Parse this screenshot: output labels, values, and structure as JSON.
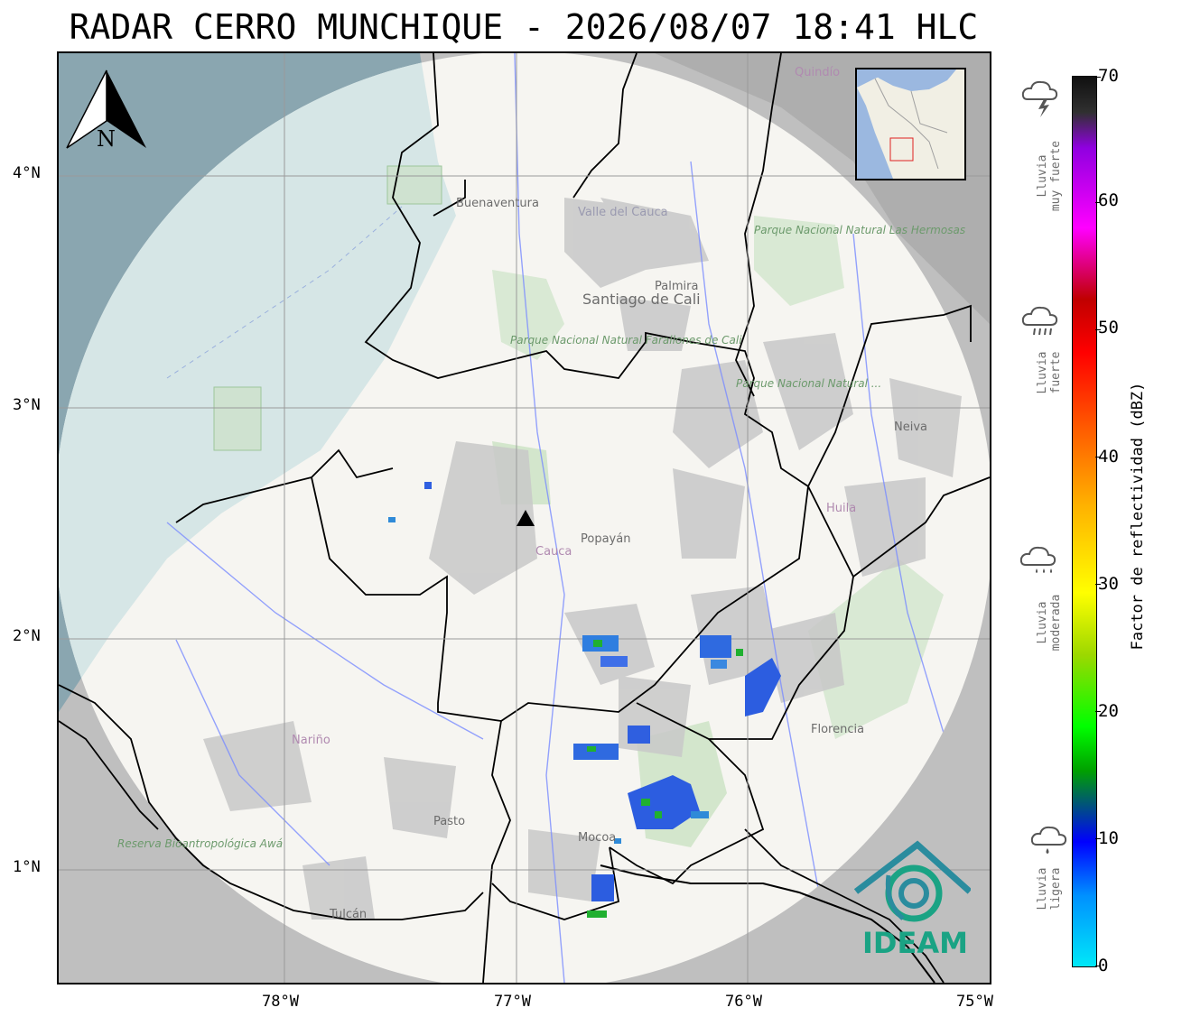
{
  "title": "RADAR CERRO MUNCHIQUE - 2026/08/07 18:41 HLC",
  "map": {
    "lat_ticks": [
      "4°N",
      "3°N",
      "2°N",
      "1°N"
    ],
    "lon_ticks": [
      "78°W",
      "77°W",
      "76°W",
      "75°W"
    ],
    "place_labels": [
      "Buenaventura",
      "Valle del Cauca",
      "Palmira",
      "Santiago de Cali",
      "Parque Nacional Natural Farallones de Cali",
      "Parque Nacional Natural Las Hermosas",
      "Parque Nacional Natural ...",
      "Neiva",
      "Huila",
      "Cauca",
      "Popayán",
      "Nariño",
      "Pasto",
      "Mocoa",
      "Florencia",
      "Reserva Bioantropológica Awá",
      "Tulcán",
      "Quindío"
    ],
    "north_label": "N",
    "radar_site_marker": "triangle-marker"
  },
  "logo": {
    "text": "IDEAM",
    "color": "#1aa384"
  },
  "colorbar": {
    "label": "Factor de reflectividad (dBZ)",
    "ticks": [
      "0",
      "10",
      "20",
      "30",
      "40",
      "50",
      "60",
      "70"
    ],
    "min": 0,
    "max": 70,
    "rain_levels": [
      {
        "label_line1": "Lluvia",
        "label_line2": "ligera",
        "icon": "light-rain-icon"
      },
      {
        "label_line1": "Lluvia",
        "label_line2": "moderada",
        "icon": "moderate-rain-icon"
      },
      {
        "label_line1": "Lluvia",
        "label_line2": "fuerte",
        "icon": "heavy-rain-icon"
      },
      {
        "label_line1": "Lluvia",
        "label_line2": "muy fuerte",
        "icon": "thunderstorm-icon"
      }
    ]
  },
  "colors": {
    "coverage": "#f5f5f3",
    "out_of_range": "#c2c2c2",
    "ocean": "#aac6d3",
    "border": "#000000",
    "rivers": "#6e82ff",
    "park": "#cfe4c6"
  }
}
